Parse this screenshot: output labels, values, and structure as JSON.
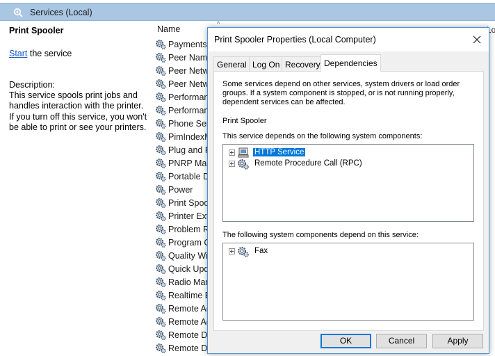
{
  "header": {
    "title": "Services (Local)",
    "icon": "services-gear-icon"
  },
  "desc_panel": {
    "service_name": "Print Spooler",
    "start_link": "Start",
    "start_suffix": " the service",
    "description_label": "Description:",
    "description": "This service spools print jobs and handles interaction with the printer. If you turn off this service, you won't be able to print or see your printers."
  },
  "list": {
    "col_name": "Name",
    "sort_arrow": "^",
    "right_col_label": "Lo",
    "rows": [
      {
        "name": "Payments",
        "st": ""
      },
      {
        "name": "Peer Name",
        "st": ""
      },
      {
        "name": "Peer Netw",
        "st": ""
      },
      {
        "name": "Peer Netw",
        "st": ""
      },
      {
        "name": "Performan",
        "st": ""
      },
      {
        "name": "Performan",
        "st": ""
      },
      {
        "name": "Phone Serv",
        "st": ""
      },
      {
        "name": "PimIndexM",
        "st": "st"
      },
      {
        "name": "Plug and P",
        "st": "st"
      },
      {
        "name": "PNRP Mac",
        "st": "st"
      },
      {
        "name": "Portable D",
        "st": "st"
      },
      {
        "name": "Power",
        "st": "st"
      },
      {
        "name": "Print Spoo",
        "st": "st"
      },
      {
        "name": "Printer Exte",
        "st": "st"
      },
      {
        "name": "Problem R",
        "st": "st"
      },
      {
        "name": "Program C",
        "st": "st"
      },
      {
        "name": "Quality Wi",
        "st": "st"
      },
      {
        "name": "Quick Upd",
        "st": "st"
      },
      {
        "name": "Radio Man",
        "st": "st"
      },
      {
        "name": "Realtime B",
        "st": "st"
      },
      {
        "name": "Remote Ac",
        "st": "st"
      },
      {
        "name": "Remote Ac",
        "st": "st"
      },
      {
        "name": "Remote De",
        "st": "st"
      },
      {
        "name": "Remote De",
        "st": "st"
      }
    ]
  },
  "dialog": {
    "title": "Print Spooler Properties (Local Computer)",
    "close_glyph": "✕",
    "tabs": [
      {
        "label": "General",
        "active": false
      },
      {
        "label": "Log On",
        "active": false
      },
      {
        "label": "Recovery",
        "active": false
      },
      {
        "label": "Dependencies",
        "active": true
      }
    ],
    "intro": "Some services depend on other services, system drivers or load order groups. If a system component is stopped, or is not running properly, dependent services can be affected.",
    "service_title": "Print Spooler",
    "depends_on_label": "This service depends on the following system components:",
    "depends_on": [
      {
        "label": "HTTP Service",
        "icon": "driver-icon",
        "selected": true
      },
      {
        "label": "Remote Procedure Call (RPC)",
        "icon": "service-gear-icon",
        "selected": false
      }
    ],
    "depend_on_this_label": "The following system components depend on this service:",
    "depend_on_this": [
      {
        "label": "Fax",
        "icon": "service-gear-icon",
        "selected": false
      }
    ],
    "buttons": {
      "ok": "OK",
      "cancel": "Cancel",
      "apply": "Apply"
    }
  },
  "colors": {
    "selection": "#0078d7",
    "header_band": "#a9c6e3",
    "link": "#0c56c0"
  }
}
